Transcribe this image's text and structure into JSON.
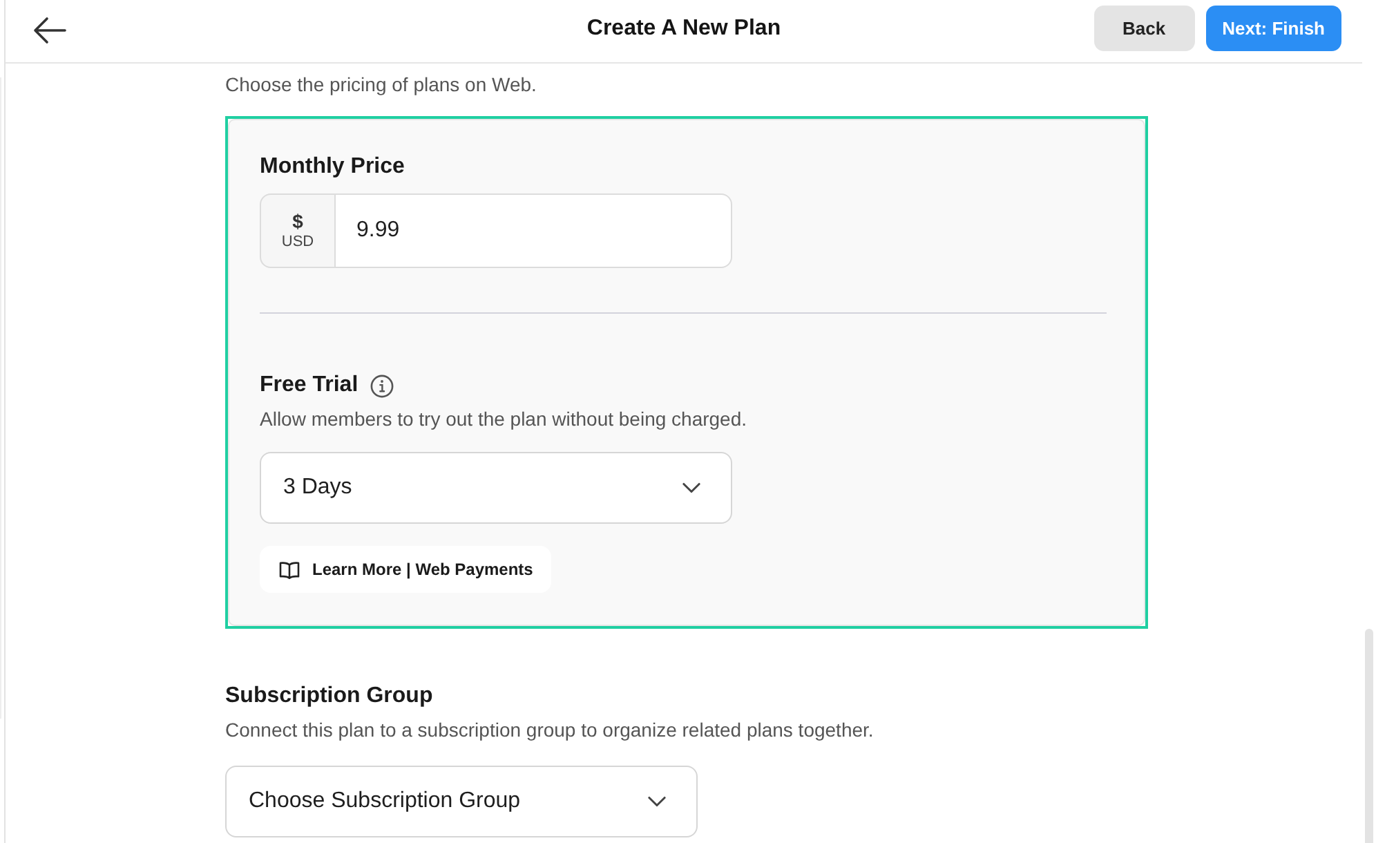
{
  "header": {
    "title": "Create A New Plan",
    "buttons": [
      {
        "label": "Back",
        "kind": "secondary"
      },
      {
        "label": "Next: Finish",
        "kind": "primary"
      }
    ]
  },
  "intro": "Choose the pricing of plans on Web.",
  "pricing_card": {
    "highlighted": true,
    "monthly_price": {
      "label": "Monthly Price",
      "currency_symbol": "$",
      "currency_code": "USD",
      "value": "9.99"
    },
    "free_trial": {
      "label": "Free Trial",
      "description": "Allow members to try out the plan without being charged.",
      "value": "3 Days"
    },
    "link": "Learn More | Web Payments"
  },
  "subscription_group": {
    "label": "Subscription Group",
    "description": "Connect this plan to a subscription group to organize related plans together.",
    "placeholder": "Choose Subscription Group"
  }
}
